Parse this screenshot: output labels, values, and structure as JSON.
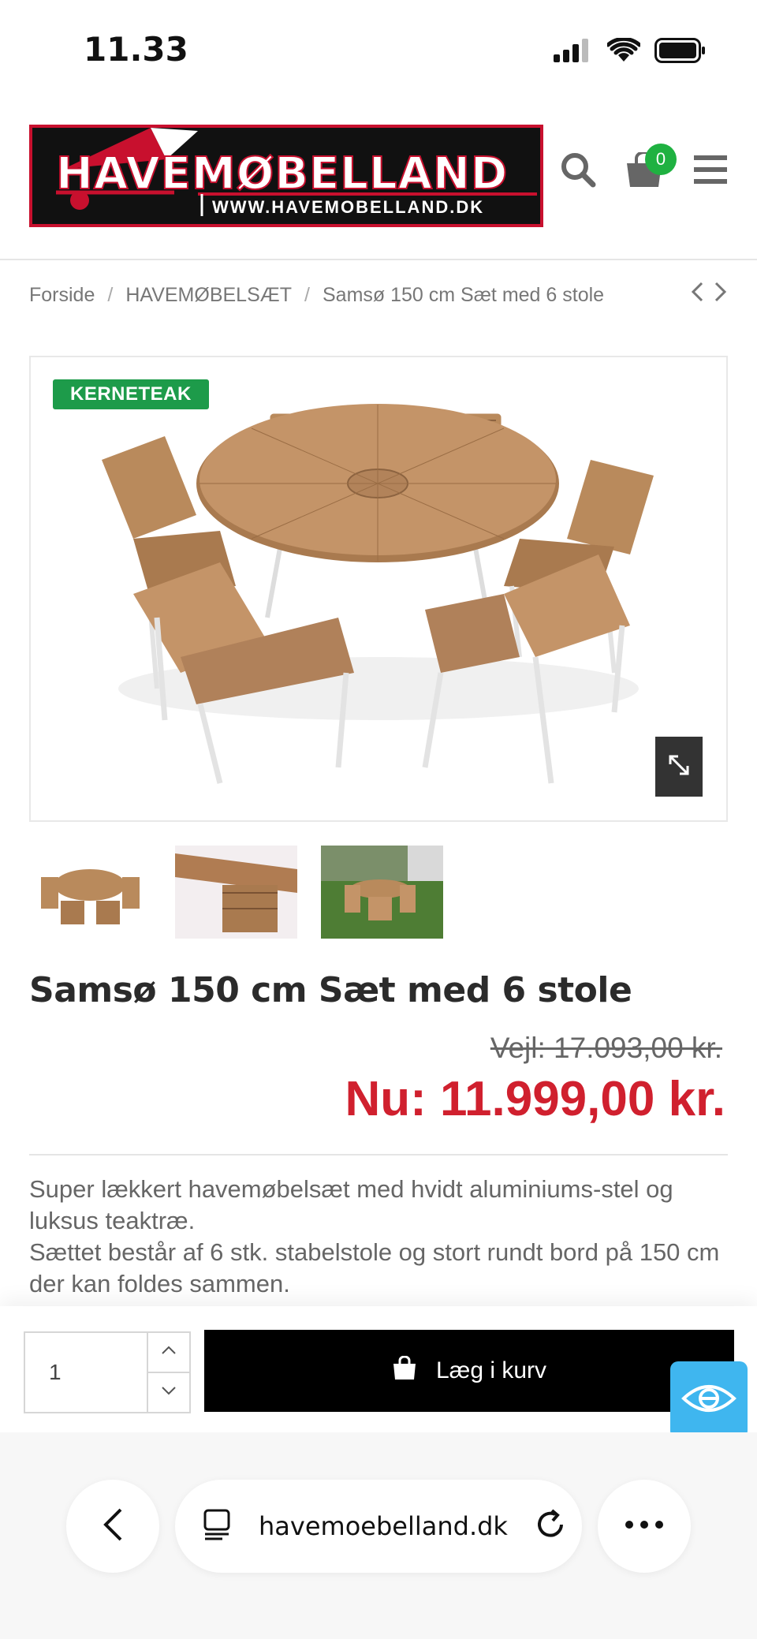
{
  "status_bar": {
    "time": "11.33"
  },
  "header": {
    "logo_text": "HAVEMØBELLAND",
    "logo_url": "WWW.HAVEMOBELLAND.DK",
    "cart_count": "0",
    "icons": [
      "search-icon",
      "cart-icon",
      "menu-icon"
    ]
  },
  "breadcrumb": {
    "items": [
      "Forside",
      "HAVEMØBELSÆT",
      "Samsø 150 cm Sæt med 6 stole"
    ],
    "separator": "/"
  },
  "product": {
    "badge": "KERNETEAK",
    "title": "Samsø 150 cm Sæt med 6 stole",
    "old_price": "Vejl: 17.093,00 kr.",
    "new_price": "Nu: 11.999,00 kr.",
    "description_1": "Super lækkert havemøbelsæt med hvidt aluminiums-stel og luksus teaktræ.",
    "description_2": "Sættet består af 6 stk. stabelstole og stort rundt bord på 150 cm der kan foldes sammen.",
    "thumbnail_count": 3
  },
  "cart": {
    "quantity": "1",
    "add_label": "Læg i kurv"
  },
  "browser": {
    "url": "havemoebelland.dk"
  },
  "colors": {
    "price_red": "#d0202e",
    "badge_green": "#1d9b4a",
    "cart_badge_green": "#1fb141",
    "accessibility_blue": "#3fb6ef"
  }
}
